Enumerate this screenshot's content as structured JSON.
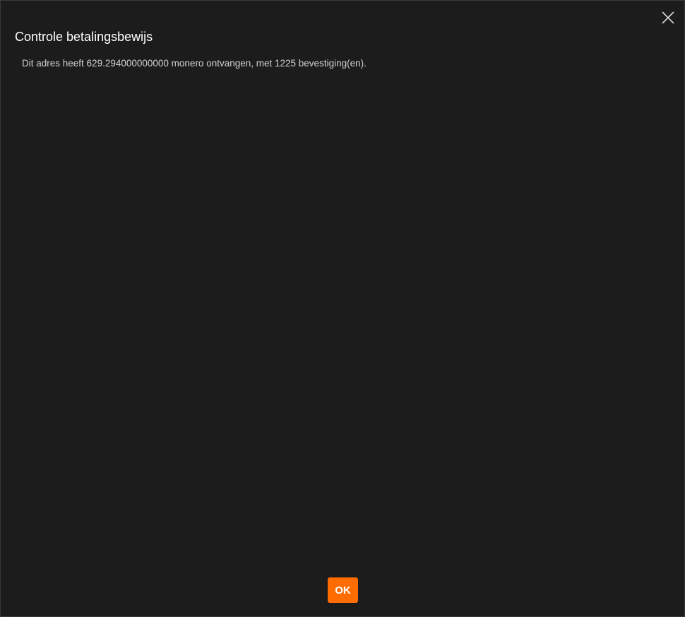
{
  "dialog": {
    "title": "Controle betalingsbewijs",
    "message": "Dit adres heeft 629.294000000000 monero ontvangen, met 1225 bevestiging(en).",
    "ok_label": "OK",
    "close_icon": "close-icon"
  },
  "colors": {
    "background": "#1c1c1c",
    "accent": "#ff6c00",
    "title_text": "#ffffff",
    "body_text": "#d2d2d2"
  }
}
